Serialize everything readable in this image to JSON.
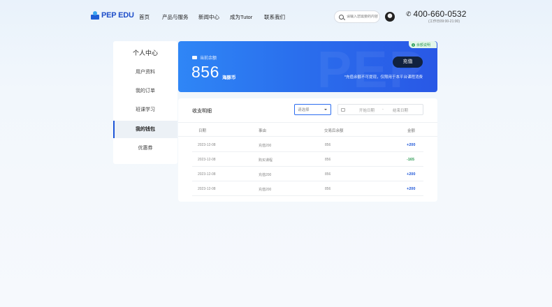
{
  "brand": {
    "logo_text": "PEP EDU",
    "accent": "#1f4fc9"
  },
  "nav": {
    "items": [
      "首页",
      "产品与服务",
      "新闻中心",
      "成为Tutor",
      "联系我们"
    ]
  },
  "search": {
    "placeholder": "请输入您需要的内容"
  },
  "contact": {
    "phone": "400-660-0532",
    "hours": "工作日09:00-21:00"
  },
  "sidebar": {
    "title": "个人中心",
    "items": [
      {
        "label": "用户资料",
        "active": false
      },
      {
        "label": "我的订单",
        "active": false
      },
      {
        "label": "班课学习",
        "active": false
      },
      {
        "label": "我的钱包",
        "active": true
      },
      {
        "label": "优惠券",
        "active": false
      }
    ]
  },
  "balance": {
    "label": "当前余额",
    "value": "856",
    "unit": "海豚币",
    "recharge_label": "充值",
    "note": "*充值余额不可提现，仅限用于本平台课程消费",
    "tag": "余额说明",
    "watermark": "PEP"
  },
  "transactions": {
    "title": "收支明细",
    "filter_placeholder": "请选择",
    "start_placeholder": "开始日期",
    "separator": "-",
    "end_placeholder": "结束日期",
    "columns": [
      "日期",
      "事由",
      "交易后余额",
      "金额"
    ],
    "rows": [
      {
        "date": "2023-12-08",
        "reason": "充值200",
        "balance": "856",
        "amount": "+200",
        "type": "pos"
      },
      {
        "date": "2023-12-08",
        "reason": "购买课程",
        "balance": "856",
        "amount": "-165",
        "type": "neg"
      },
      {
        "date": "2023-12-08",
        "reason": "充值200",
        "balance": "856",
        "amount": "+200",
        "type": "pos"
      },
      {
        "date": "2023-12-08",
        "reason": "充值200",
        "balance": "856",
        "amount": "+200",
        "type": "pos"
      }
    ]
  }
}
